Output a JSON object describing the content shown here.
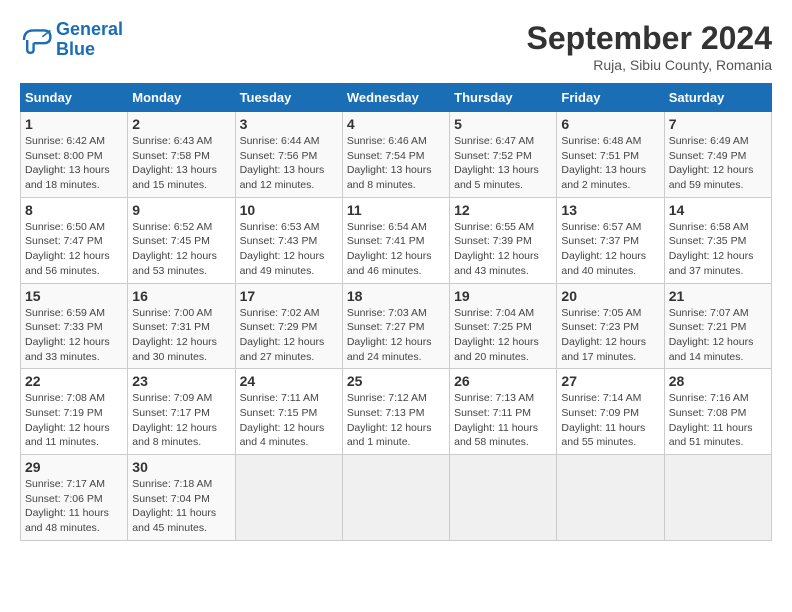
{
  "header": {
    "logo_line1": "General",
    "logo_line2": "Blue",
    "title": "September 2024",
    "location": "Ruja, Sibiu County, Romania"
  },
  "calendar": {
    "weekdays": [
      "Sunday",
      "Monday",
      "Tuesday",
      "Wednesday",
      "Thursday",
      "Friday",
      "Saturday"
    ],
    "weeks": [
      [
        {
          "day": "",
          "empty": true
        },
        {
          "day": "",
          "empty": true
        },
        {
          "day": "",
          "empty": true
        },
        {
          "day": "",
          "empty": true
        },
        {
          "day": "",
          "empty": true
        },
        {
          "day": "",
          "empty": true
        },
        {
          "day": "7",
          "sunrise": "6:49 AM",
          "sunset": "7:49 PM",
          "daylight": "12 hours and 59 minutes"
        }
      ],
      [
        {
          "day": "1",
          "sunrise": "6:42 AM",
          "sunset": "8:00 PM",
          "daylight": "13 hours and 18 minutes"
        },
        {
          "day": "2",
          "sunrise": "6:43 AM",
          "sunset": "7:58 PM",
          "daylight": "13 hours and 15 minutes"
        },
        {
          "day": "3",
          "sunrise": "6:44 AM",
          "sunset": "7:56 PM",
          "daylight": "13 hours and 12 minutes"
        },
        {
          "day": "4",
          "sunrise": "6:46 AM",
          "sunset": "7:54 PM",
          "daylight": "13 hours and 8 minutes"
        },
        {
          "day": "5",
          "sunrise": "6:47 AM",
          "sunset": "7:52 PM",
          "daylight": "13 hours and 5 minutes"
        },
        {
          "day": "6",
          "sunrise": "6:48 AM",
          "sunset": "7:51 PM",
          "daylight": "13 hours and 2 minutes"
        },
        {
          "day": "7",
          "sunrise": "6:49 AM",
          "sunset": "7:49 PM",
          "daylight": "12 hours and 59 minutes"
        }
      ],
      [
        {
          "day": "8",
          "sunrise": "6:50 AM",
          "sunset": "7:47 PM",
          "daylight": "12 hours and 56 minutes"
        },
        {
          "day": "9",
          "sunrise": "6:52 AM",
          "sunset": "7:45 PM",
          "daylight": "12 hours and 53 minutes"
        },
        {
          "day": "10",
          "sunrise": "6:53 AM",
          "sunset": "7:43 PM",
          "daylight": "12 hours and 49 minutes"
        },
        {
          "day": "11",
          "sunrise": "6:54 AM",
          "sunset": "7:41 PM",
          "daylight": "12 hours and 46 minutes"
        },
        {
          "day": "12",
          "sunrise": "6:55 AM",
          "sunset": "7:39 PM",
          "daylight": "12 hours and 43 minutes"
        },
        {
          "day": "13",
          "sunrise": "6:57 AM",
          "sunset": "7:37 PM",
          "daylight": "12 hours and 40 minutes"
        },
        {
          "day": "14",
          "sunrise": "6:58 AM",
          "sunset": "7:35 PM",
          "daylight": "12 hours and 37 minutes"
        }
      ],
      [
        {
          "day": "15",
          "sunrise": "6:59 AM",
          "sunset": "7:33 PM",
          "daylight": "12 hours and 33 minutes"
        },
        {
          "day": "16",
          "sunrise": "7:00 AM",
          "sunset": "7:31 PM",
          "daylight": "12 hours and 30 minutes"
        },
        {
          "day": "17",
          "sunrise": "7:02 AM",
          "sunset": "7:29 PM",
          "daylight": "12 hours and 27 minutes"
        },
        {
          "day": "18",
          "sunrise": "7:03 AM",
          "sunset": "7:27 PM",
          "daylight": "12 hours and 24 minutes"
        },
        {
          "day": "19",
          "sunrise": "7:04 AM",
          "sunset": "7:25 PM",
          "daylight": "12 hours and 20 minutes"
        },
        {
          "day": "20",
          "sunrise": "7:05 AM",
          "sunset": "7:23 PM",
          "daylight": "12 hours and 17 minutes"
        },
        {
          "day": "21",
          "sunrise": "7:07 AM",
          "sunset": "7:21 PM",
          "daylight": "12 hours and 14 minutes"
        }
      ],
      [
        {
          "day": "22",
          "sunrise": "7:08 AM",
          "sunset": "7:19 PM",
          "daylight": "12 hours and 11 minutes"
        },
        {
          "day": "23",
          "sunrise": "7:09 AM",
          "sunset": "7:17 PM",
          "daylight": "12 hours and 8 minutes"
        },
        {
          "day": "24",
          "sunrise": "7:11 AM",
          "sunset": "7:15 PM",
          "daylight": "12 hours and 4 minutes"
        },
        {
          "day": "25",
          "sunrise": "7:12 AM",
          "sunset": "7:13 PM",
          "daylight": "12 hours and 1 minute"
        },
        {
          "day": "26",
          "sunrise": "7:13 AM",
          "sunset": "7:11 PM",
          "daylight": "11 hours and 58 minutes"
        },
        {
          "day": "27",
          "sunrise": "7:14 AM",
          "sunset": "7:09 PM",
          "daylight": "11 hours and 55 minutes"
        },
        {
          "day": "28",
          "sunrise": "7:16 AM",
          "sunset": "7:08 PM",
          "daylight": "11 hours and 51 minutes"
        }
      ],
      [
        {
          "day": "29",
          "sunrise": "7:17 AM",
          "sunset": "7:06 PM",
          "daylight": "11 hours and 48 minutes"
        },
        {
          "day": "30",
          "sunrise": "7:18 AM",
          "sunset": "7:04 PM",
          "daylight": "11 hours and 45 minutes"
        },
        {
          "day": "",
          "empty": true
        },
        {
          "day": "",
          "empty": true
        },
        {
          "day": "",
          "empty": true
        },
        {
          "day": "",
          "empty": true
        },
        {
          "day": "",
          "empty": true
        }
      ]
    ]
  }
}
